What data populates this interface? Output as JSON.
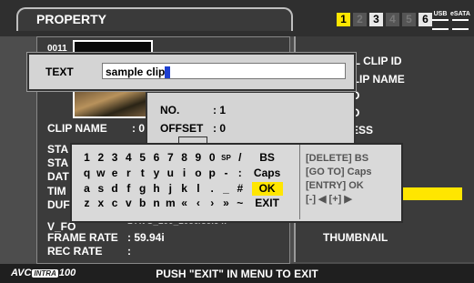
{
  "header": {
    "title": "PROPERTY",
    "slots": [
      "1",
      "2",
      "3",
      "4",
      "5",
      "6"
    ],
    "usb_label": "USB",
    "esata_label": "eSATA"
  },
  "clip_info": {
    "clip_id_fragment": "0011",
    "clip_name_label": "CLIP NAME",
    "clip_name_value": ": 0",
    "rows_prefix": [
      "STA",
      "STA",
      "DAT",
      "TIM",
      "DUF"
    ],
    "video_format_label": "V_FO",
    "video_format_value": "1 AVC_100_1080/59.94i",
    "frame_rate_label": "FRAME RATE",
    "frame_rate_value": ": 59.94i",
    "rec_rate_label": "REC RATE",
    "rec_rate_value": ":"
  },
  "right_menu": {
    "items": [
      "AL CLIP ID",
      "CLIP NAME",
      "O",
      "O",
      "ESS"
    ],
    "thumbnail": "THUMBNAIL"
  },
  "text_dialog": {
    "label": "TEXT",
    "value": "sample clip"
  },
  "info_dialog": {
    "no_label": "NO.",
    "no_value": ": 1",
    "offset_label": "OFFSET",
    "offset_value": ": 0"
  },
  "keyboard": {
    "rows": [
      [
        "1",
        "2",
        "3",
        "4",
        "5",
        "6",
        "7",
        "8",
        "9",
        "0",
        "SP",
        "/"
      ],
      [
        "q",
        "w",
        "e",
        "r",
        "t",
        "y",
        "u",
        "i",
        "o",
        "p",
        "-",
        ":"
      ],
      [
        "a",
        "s",
        "d",
        "f",
        "g",
        "h",
        "j",
        "k",
        "l",
        ".",
        "_",
        "#"
      ],
      [
        "z",
        "x",
        "c",
        "v",
        "b",
        "n",
        "m",
        "«",
        "‹",
        "›",
        "»",
        "~"
      ]
    ],
    "actions": [
      "BS",
      "Caps",
      "OK",
      "EXIT"
    ],
    "help": [
      "[DELETE] BS",
      "[GO TO] Caps",
      "[ENTRY]  OK",
      "[-] ◀    [+] ▶"
    ]
  },
  "footer": {
    "logo_a": "AVC",
    "logo_b": "INTRA",
    "logo_c": "100",
    "message": "PUSH \"EXIT\" IN MENU TO EXIT"
  },
  "colors": {
    "accent": "#ffe600",
    "background": "#4d4d4d"
  }
}
